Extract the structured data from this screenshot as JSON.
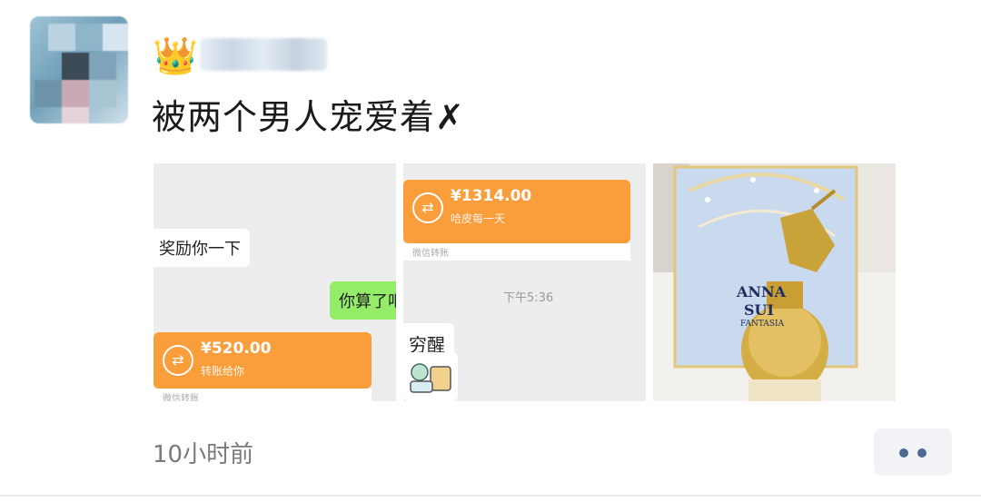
{
  "post": {
    "crown_emoji": "👑",
    "text": "被两个男人宠爱着✗",
    "timestamp": "10小时前"
  },
  "images": [
    {
      "reward_text": "奖励你一下",
      "green_text": "你算了吧",
      "transfer_amount": "¥520.00",
      "transfer_note": "转账给你",
      "transfer_footer": "微信转账"
    },
    {
      "transfer_amount": "¥1314.00",
      "transfer_note": "哈皮每一天",
      "transfer_footer": "微信转账",
      "time_label": "下午5:36",
      "reply_text": "穷醒"
    },
    {
      "brand_line1": "ANNA",
      "brand_line2": "SUI",
      "product_line": "FANTASIA"
    }
  ],
  "colors": {
    "transfer_orange": "#fa9d3b",
    "chat_green": "#95ec69",
    "more_dots": "#4f6a92"
  }
}
